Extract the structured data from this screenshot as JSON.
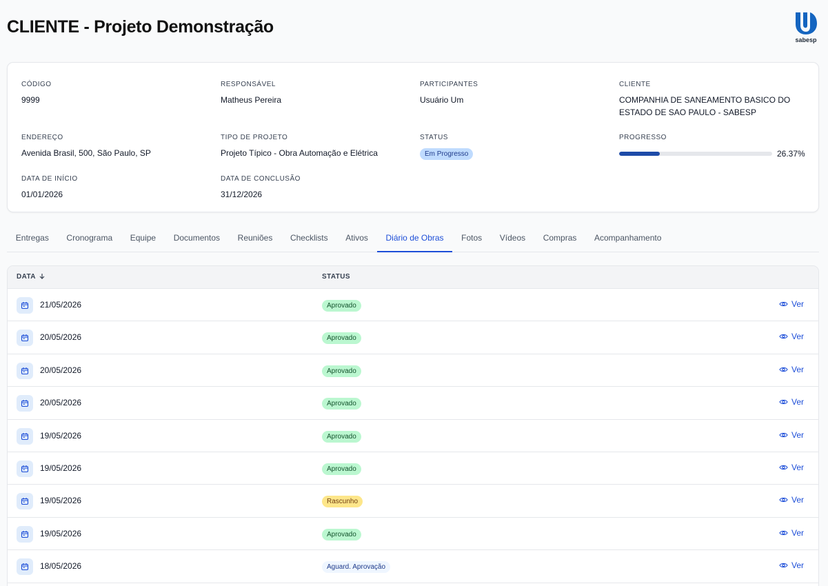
{
  "header": {
    "title": "CLIENTE - Projeto Demonstração",
    "logo_text": "sabesp"
  },
  "info": {
    "codigo": {
      "label": "CÓDIGO",
      "value": "9999"
    },
    "responsavel": {
      "label": "RESPONSÁVEL",
      "value": "Matheus Pereira"
    },
    "participantes": {
      "label": "PARTICIPANTES",
      "value": "Usuário Um"
    },
    "cliente": {
      "label": "CLIENTE",
      "line1": "COMPANHIA DE SANEAMENTO BASICO DO",
      "line2": "ESTADO DE SAO PAULO - SABESP"
    },
    "endereco": {
      "label": "ENDEREÇO",
      "value": "Avenida Brasil, 500, São Paulo, SP"
    },
    "tipo": {
      "label": "TIPO DE PROJETO",
      "value": "Projeto Típico - Obra Automação e Elétrica"
    },
    "status": {
      "label": "STATUS",
      "value": "Em Progresso"
    },
    "progresso": {
      "label": "PROGRESSO",
      "value": "26.37%",
      "fraction": 0.2637
    },
    "inicio": {
      "label": "DATA DE INÍCIO",
      "value": "01/01/2026"
    },
    "conclusao": {
      "label": "DATA DE CONCLUSÃO",
      "value": "31/12/2026"
    }
  },
  "tabs": [
    "Entregas",
    "Cronograma",
    "Equipe",
    "Documentos",
    "Reuniões",
    "Checklists",
    "Ativos",
    "Diário de Obras",
    "Fotos",
    "Vídeos",
    "Compras",
    "Acompanhamento"
  ],
  "active_tab": "Diário de Obras",
  "table": {
    "headers": {
      "data": "DATA",
      "status": "STATUS"
    },
    "action_label": "Ver",
    "rows": [
      {
        "date": "21/05/2026",
        "status": "Aprovado",
        "kind": "aprovado"
      },
      {
        "date": "20/05/2026",
        "status": "Aprovado",
        "kind": "aprovado"
      },
      {
        "date": "20/05/2026",
        "status": "Aprovado",
        "kind": "aprovado"
      },
      {
        "date": "20/05/2026",
        "status": "Aprovado",
        "kind": "aprovado"
      },
      {
        "date": "19/05/2026",
        "status": "Aprovado",
        "kind": "aprovado"
      },
      {
        "date": "19/05/2026",
        "status": "Aprovado",
        "kind": "aprovado"
      },
      {
        "date": "19/05/2026",
        "status": "Rascunho",
        "kind": "rascunho"
      },
      {
        "date": "19/05/2026",
        "status": "Aprovado",
        "kind": "aprovado"
      },
      {
        "date": "18/05/2026",
        "status": "Aguard. Aprovação",
        "kind": "aguard"
      }
    ]
  },
  "colors": {
    "accent": "#1d4ed8",
    "progress": "#1e4ba8",
    "logo": "#1565c0"
  },
  "icons": [
    "calendar-icon",
    "eye-icon",
    "sort-arrow-down-icon"
  ]
}
